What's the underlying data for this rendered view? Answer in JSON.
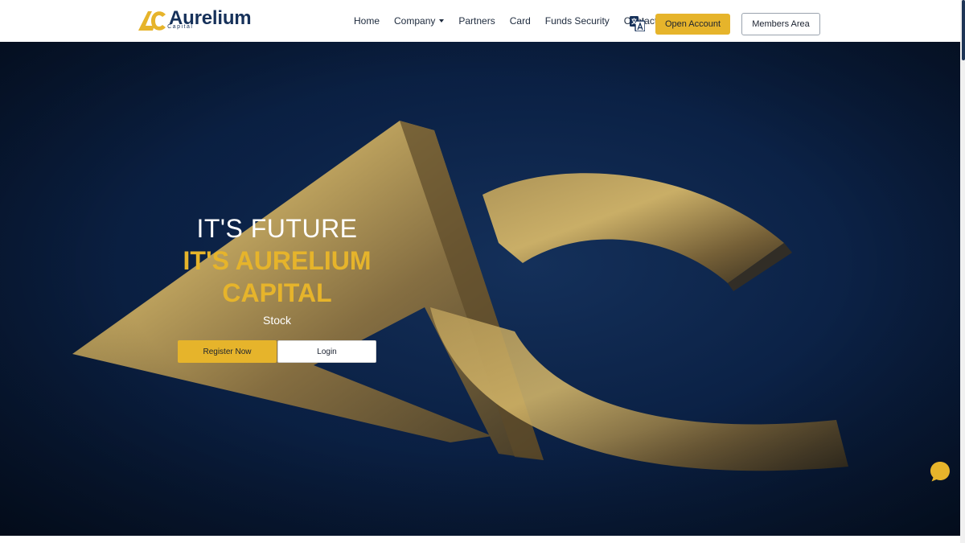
{
  "brand": {
    "name": "Aurelium",
    "sub": "Capital",
    "colors": {
      "navy": "#16315a",
      "gold": "#e6b42b"
    }
  },
  "nav": {
    "home": "Home",
    "company": "Company",
    "partners": "Partners",
    "card": "Card",
    "funds_security": "Funds Security",
    "contact": "Contact",
    "translate_icon": "translate-icon",
    "open_account": "Open Account",
    "members_area": "Members Area"
  },
  "hero": {
    "line1": "IT'S FUTURE",
    "line2": "IT'S AURELIUM",
    "line3": "CAPITAL",
    "line4": "Stock",
    "register_label": "Register Now",
    "login_label": "Login"
  },
  "chat": {
    "icon": "chat-icon"
  }
}
